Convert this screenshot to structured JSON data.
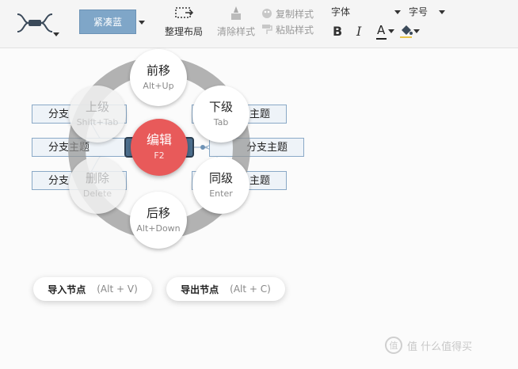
{
  "toolbar": {
    "layout_icon": "structure-icon",
    "theme_label": "紧凑蓝",
    "arrange_label": "整理布局",
    "clear_style_label": "清除样式",
    "copy_style_label": "复制样式",
    "paste_style_label": "粘贴样式",
    "font_label": "字体",
    "font_size_label": "字号",
    "bold_label": "B",
    "italic_label": "I",
    "font_color_label": "A",
    "accent_color": "#7fa6c8"
  },
  "mindmap": {
    "branches_left": [
      "分支",
      "分支主题",
      "分支"
    ],
    "branches_right": [
      "主题",
      "分支主题",
      "主题"
    ]
  },
  "menu": {
    "center": {
      "label": "编辑",
      "key": "F2"
    },
    "up": {
      "label": "前移",
      "key": "Alt+Up"
    },
    "parent": {
      "label": "上级",
      "key": "Shift+Tab"
    },
    "child": {
      "label": "下级",
      "key": "Tab"
    },
    "delete": {
      "label": "删除",
      "key": "Delete"
    },
    "sibling": {
      "label": "同级",
      "key": "Enter"
    },
    "down": {
      "label": "后移",
      "key": "Alt+Down"
    },
    "center_color": "#e85a5a"
  },
  "actions": {
    "import_label": "导入节点",
    "import_key": "(Alt + V)",
    "export_label": "导出节点",
    "export_key": "(Alt + C)"
  },
  "watermark": {
    "text": "值 什么值得买"
  }
}
